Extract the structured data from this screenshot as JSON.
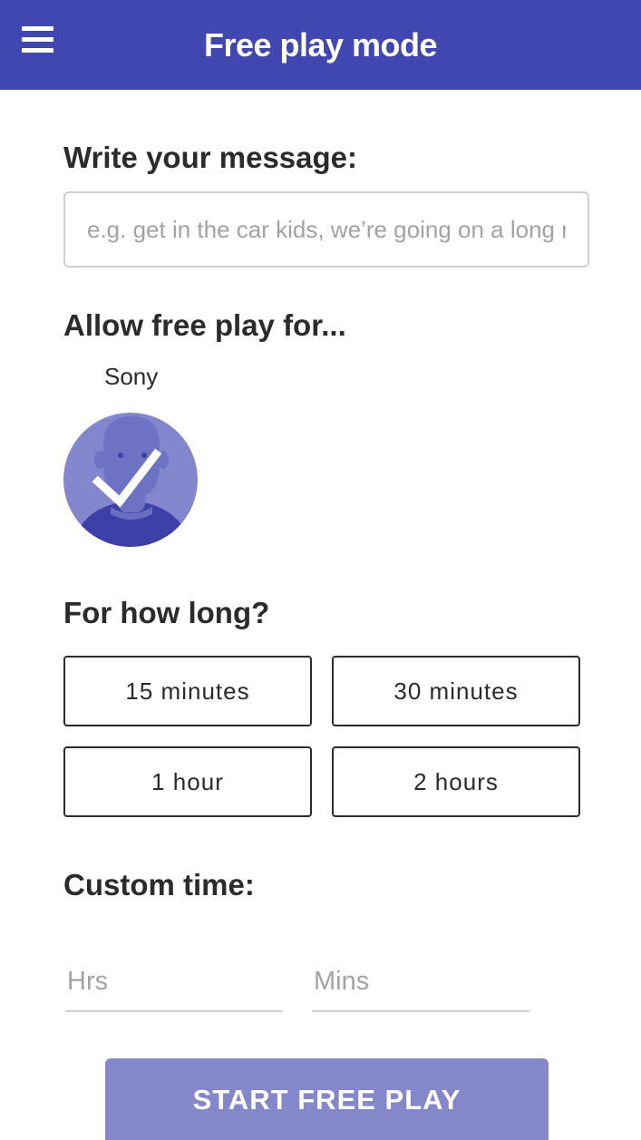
{
  "header": {
    "title": "Free play mode",
    "menu_icon": "hamburger-menu-icon",
    "background": "#4147b0"
  },
  "message": {
    "heading": "Write your message:",
    "placeholder": "e.g. get in the car kids, we’re going on a long r",
    "value": ""
  },
  "players": {
    "heading": "Allow free play for...",
    "items": [
      {
        "name": "Sony",
        "selected": true,
        "avatar_icon": "person-avatar-icon",
        "check_icon": "checkmark-icon"
      }
    ]
  },
  "duration": {
    "heading": "For how long?",
    "options": [
      "15 minutes",
      "30 minutes",
      "1 hour",
      "2 hours"
    ]
  },
  "custom_time": {
    "heading": "Custom time:",
    "hours_placeholder": "Hrs",
    "minutes_placeholder": "Mins"
  },
  "actions": {
    "start_label": "START FREE PLAY",
    "start_color": "#8487c9"
  }
}
